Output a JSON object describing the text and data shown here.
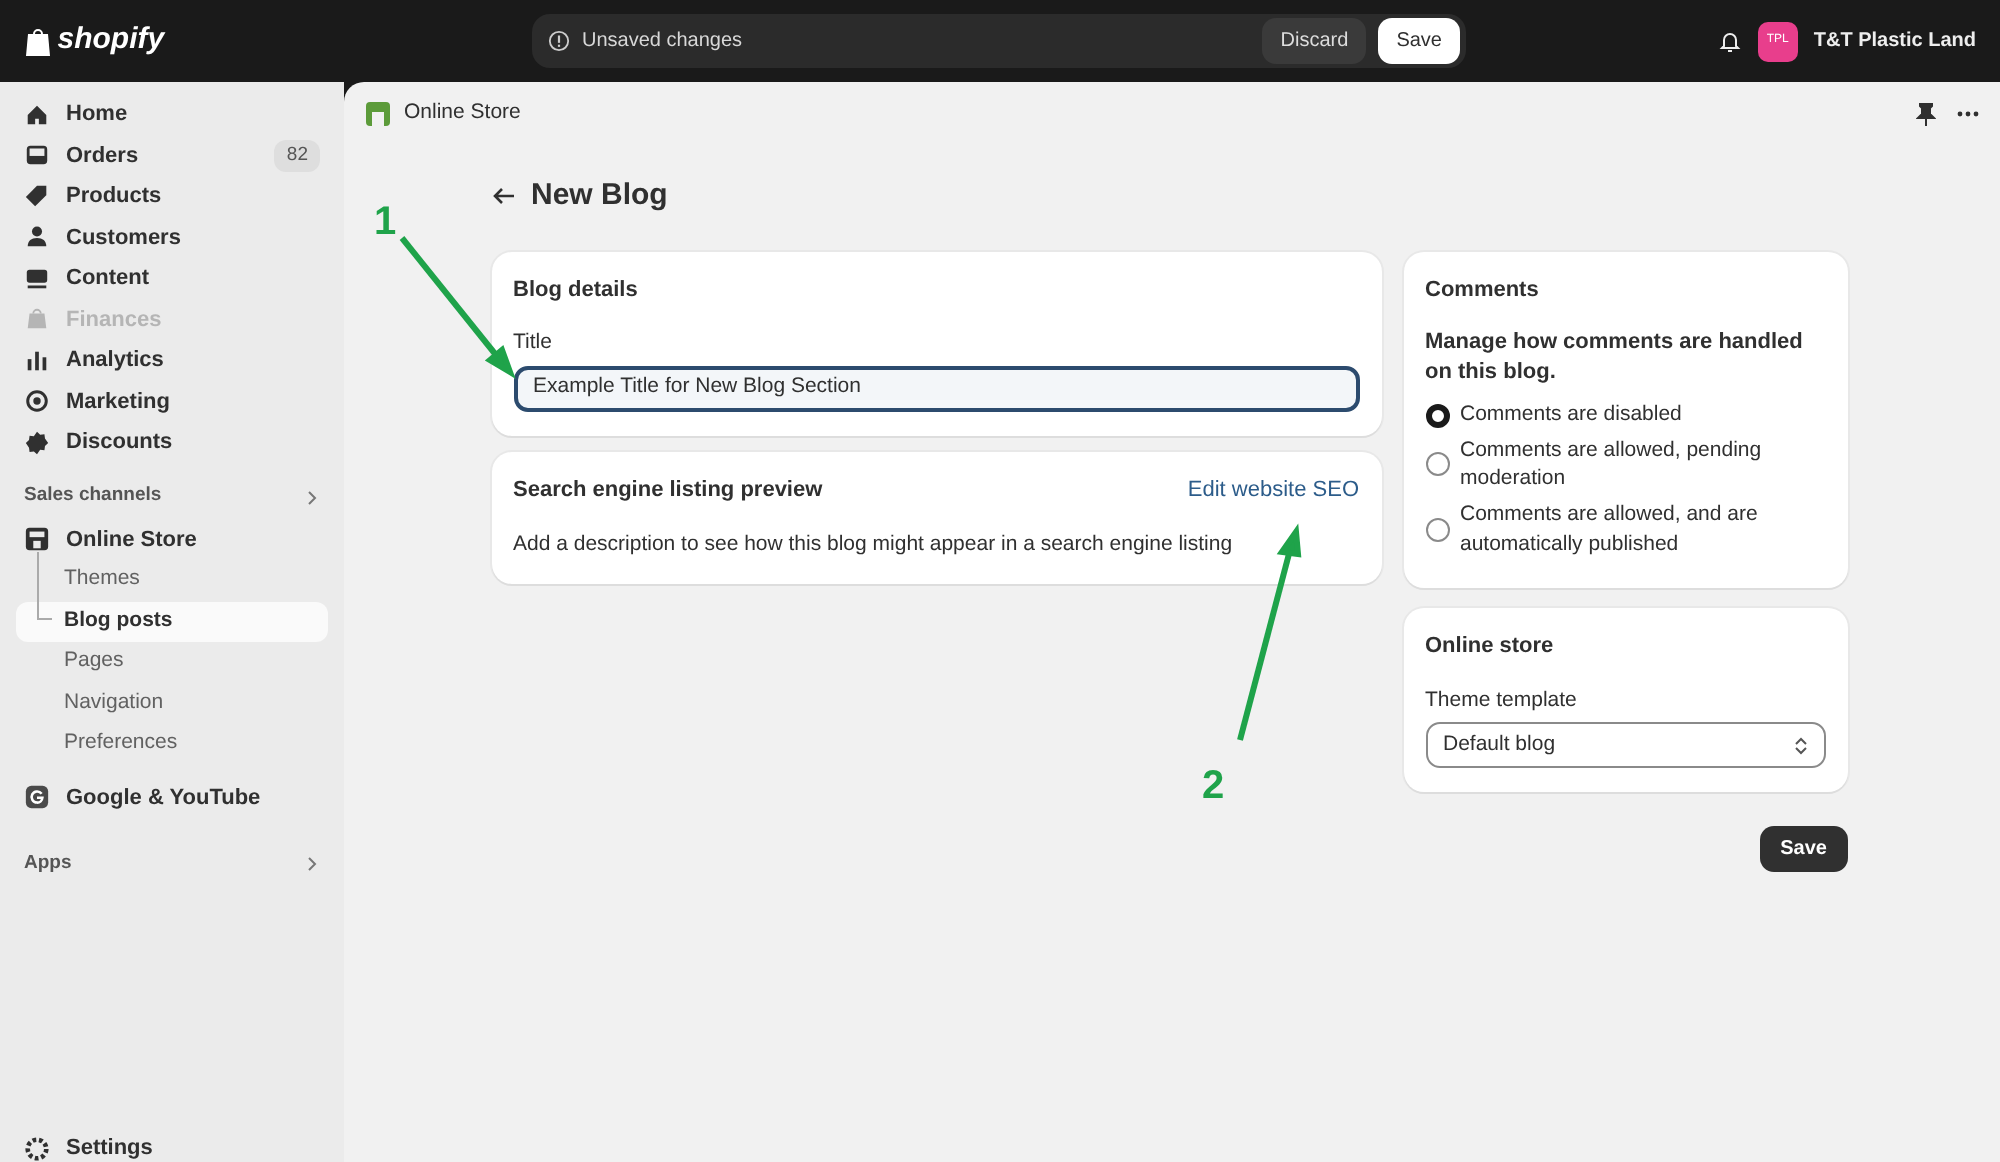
{
  "topbar": {
    "brand": "shopify",
    "unsaved": {
      "message": "Unsaved changes",
      "buttons": [
        {
          "label": "Discard",
          "kind": "secondary"
        },
        {
          "label": "Save",
          "kind": "primary"
        }
      ]
    },
    "store": {
      "initials": "TPL",
      "name": "T&T Plastic Land"
    }
  },
  "sidebar": {
    "main": [
      {
        "label": "Home",
        "kind": "home",
        "disabled": false
      },
      {
        "label": "Orders",
        "kind": "orders",
        "badge": "82",
        "disabled": false
      },
      {
        "label": "Products",
        "kind": "tag",
        "disabled": false
      },
      {
        "label": "Customers",
        "kind": "person",
        "disabled": false
      },
      {
        "label": "Content",
        "kind": "content",
        "disabled": false
      },
      {
        "label": "Finances",
        "kind": "bank",
        "disabled": true
      },
      {
        "label": "Analytics",
        "kind": "bars",
        "disabled": false
      },
      {
        "label": "Marketing",
        "kind": "target",
        "disabled": false
      },
      {
        "label": "Discounts",
        "kind": "discount",
        "disabled": false
      }
    ],
    "channels_heading": "Sales channels",
    "channels": [
      {
        "label": "Online Store",
        "kind": "store",
        "children": [
          {
            "label": "Themes",
            "selected": false
          },
          {
            "label": "Blog posts",
            "selected": true
          },
          {
            "label": "Pages",
            "selected": false
          },
          {
            "label": "Navigation",
            "selected": false
          },
          {
            "label": "Preferences",
            "selected": false
          }
        ]
      },
      {
        "label": "Google & YouTube",
        "kind": "google"
      }
    ],
    "apps_heading": "Apps",
    "settings": "Settings"
  },
  "page_header": {
    "breadcrumb": "Online Store"
  },
  "title": "New Blog",
  "blog_details": {
    "heading": "Blog details",
    "field": {
      "label": "Title",
      "value": "Example Title for New Blog Section",
      "focused": true
    }
  },
  "seo": {
    "heading": "Search engine listing preview",
    "link": "Edit website SEO",
    "description": "Add a description to see how this blog might appear in a search engine listing"
  },
  "comments": {
    "heading": "Comments",
    "prompt": "Manage how comments are handled on this blog.",
    "options": [
      {
        "label": "Comments are disabled",
        "selected": true
      },
      {
        "label": "Comments are allowed, pending moderation",
        "selected": false
      },
      {
        "label": "Comments are allowed, and are automatically published",
        "selected": false
      }
    ]
  },
  "online_store": {
    "heading": "Online store",
    "field": {
      "label": "Theme template",
      "value": "Default blog"
    }
  },
  "save_button": "Save",
  "annotations": [
    {
      "label": "1"
    },
    {
      "label": "2"
    }
  ]
}
